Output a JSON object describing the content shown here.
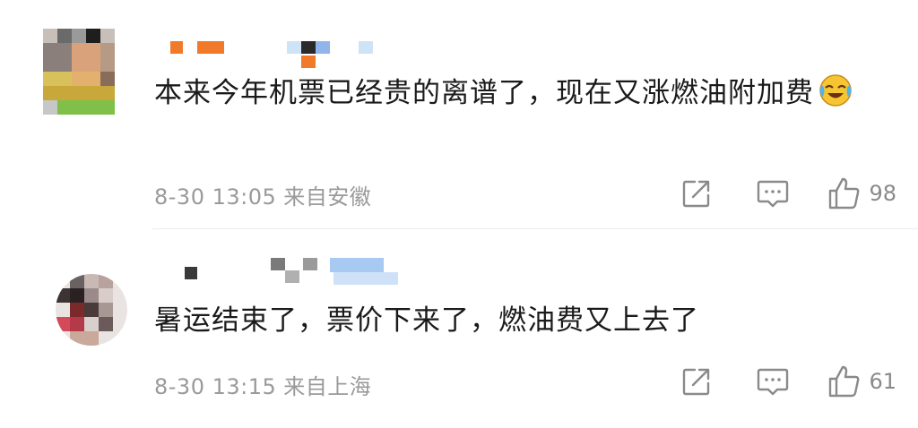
{
  "comments": [
    {
      "text": "本来今年机票已经贵的离谱了，现在又涨燃油附加费",
      "emoji": "laughing-crying-emoji",
      "date": "8-30 13:05",
      "location": "来自安徽",
      "likes": "98"
    },
    {
      "text": "暑运结束了，票价下来了，燃油费又上去了",
      "emoji": "",
      "date": "8-30 13:15",
      "location": "来自上海",
      "likes": "61"
    }
  ],
  "icons": {
    "share": "share-icon",
    "reply": "comment-icon",
    "like": "thumbs-up-icon"
  },
  "colors": {
    "text": "#1a1a1a",
    "meta": "#9a9a9a",
    "icon": "#8a8a8a"
  }
}
